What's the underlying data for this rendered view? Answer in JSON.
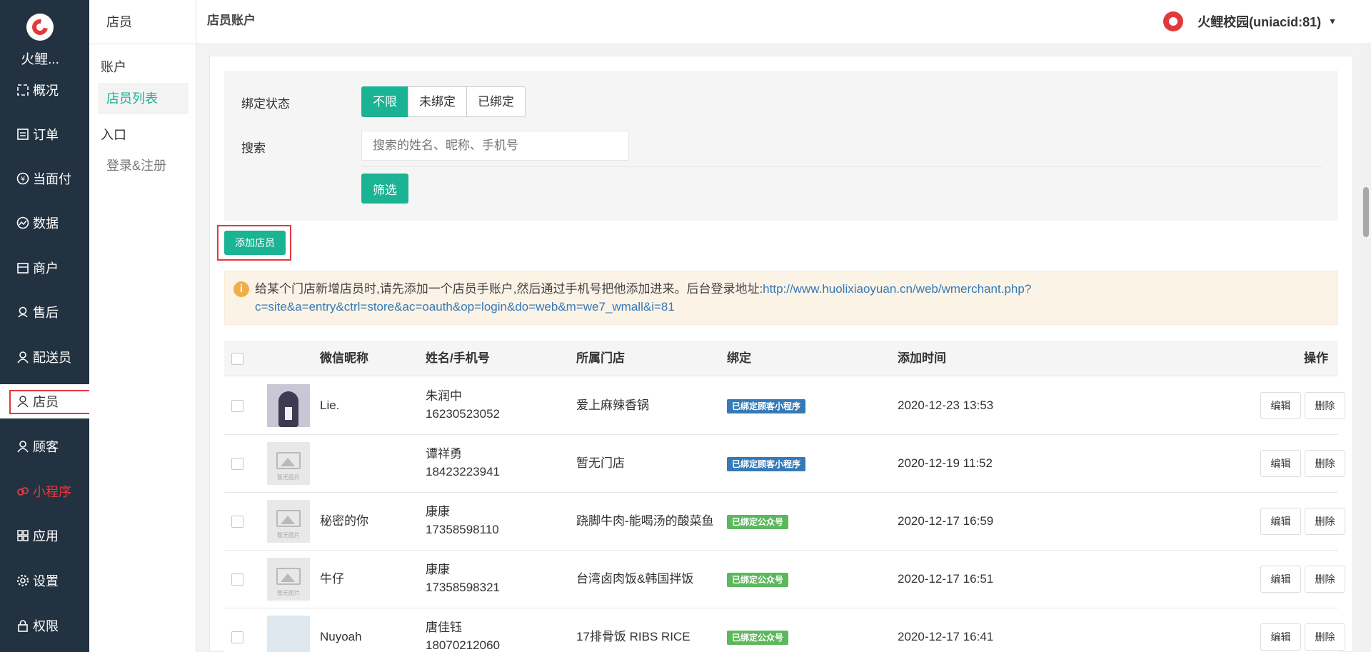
{
  "nav": {
    "brand": "火鲤...",
    "items": [
      {
        "label": "概况",
        "icon": "overview-icon"
      },
      {
        "label": "订单",
        "icon": "order-icon"
      },
      {
        "label": "当面付",
        "icon": "yen-icon"
      },
      {
        "label": "数据",
        "icon": "chart-icon"
      },
      {
        "label": "商户",
        "icon": "store-icon"
      },
      {
        "label": "售后",
        "icon": "aftersale-icon"
      },
      {
        "label": "配送员",
        "icon": "courier-icon"
      },
      {
        "label": "店员",
        "icon": "clerk-icon"
      },
      {
        "label": "顾客",
        "icon": "customer-icon"
      },
      {
        "label": "小程序",
        "icon": "miniprogram-icon"
      },
      {
        "label": "应用",
        "icon": "apps-icon"
      },
      {
        "label": "设置",
        "icon": "gear-icon"
      },
      {
        "label": "权限",
        "icon": "lock-icon"
      }
    ]
  },
  "submenu": {
    "title": "店员",
    "group1": "账户",
    "item1": "店员列表",
    "group2": "入口",
    "item2": "登录&注册"
  },
  "header": {
    "page_title": "店员账户",
    "account": "火鲤校园(uniacid:81)"
  },
  "filter": {
    "bind_label": "绑定状态",
    "bind_options": [
      "不限",
      "未绑定",
      "已绑定"
    ],
    "search_label": "搜索",
    "search_placeholder": "搜索的姓名、昵称、手机号",
    "filter_button": "筛选"
  },
  "add_button": "添加店员",
  "notice": {
    "text": "给某个门店新增店员时,请先添加一个店员手账户,然后通过手机号把他添加进来。后台登录地址:",
    "link": "http://www.huolixiaoyuan.cn/web/wmerchant.php?c=site&a=entry&ctrl=store&ac=oauth&op=login&do=web&m=we7_wmall&i=81"
  },
  "table": {
    "headers": {
      "nickname": "微信昵称",
      "name_phone": "姓名/手机号",
      "store": "所属门店",
      "bind": "绑定",
      "added": "添加时间",
      "action": "操作"
    },
    "placeholder_text": "暂无图片",
    "edit": "编辑",
    "delete": "删除",
    "rows": [
      {
        "nickname": "Lie.",
        "name": "朱润中",
        "phone": "16230523052",
        "store": "爱上麻辣香锅",
        "bind": "已绑定顾客小程序",
        "bind_color": "#337ab7",
        "time": "2020-12-23 13:53"
      },
      {
        "nickname": "",
        "name": "谭祥勇",
        "phone": "18423223941",
        "store": "暂无门店",
        "bind": "已绑定顾客小程序",
        "bind_color": "#337ab7",
        "time": "2020-12-19 11:52"
      },
      {
        "nickname": "秘密的你",
        "name": "康康",
        "phone": "17358598110",
        "store": "跷脚牛肉-能喝汤的酸菜鱼",
        "bind": "已绑定公众号",
        "bind_color": "#5cb85c",
        "time": "2020-12-17 16:59"
      },
      {
        "nickname": "牛仔",
        "name": "康康",
        "phone": "17358598321",
        "store": "台湾卤肉饭&韩国拌饭",
        "bind": "已绑定公众号",
        "bind_color": "#5cb85c",
        "time": "2020-12-17 16:51"
      },
      {
        "nickname": "Nuyoah",
        "name": "唐佳钰",
        "phone": "18070212060",
        "store": "17排骨饭 RIBS RICE",
        "bind": "已绑定公众号",
        "bind_color": "#5cb85c",
        "time": "2020-12-17 16:41"
      }
    ]
  }
}
